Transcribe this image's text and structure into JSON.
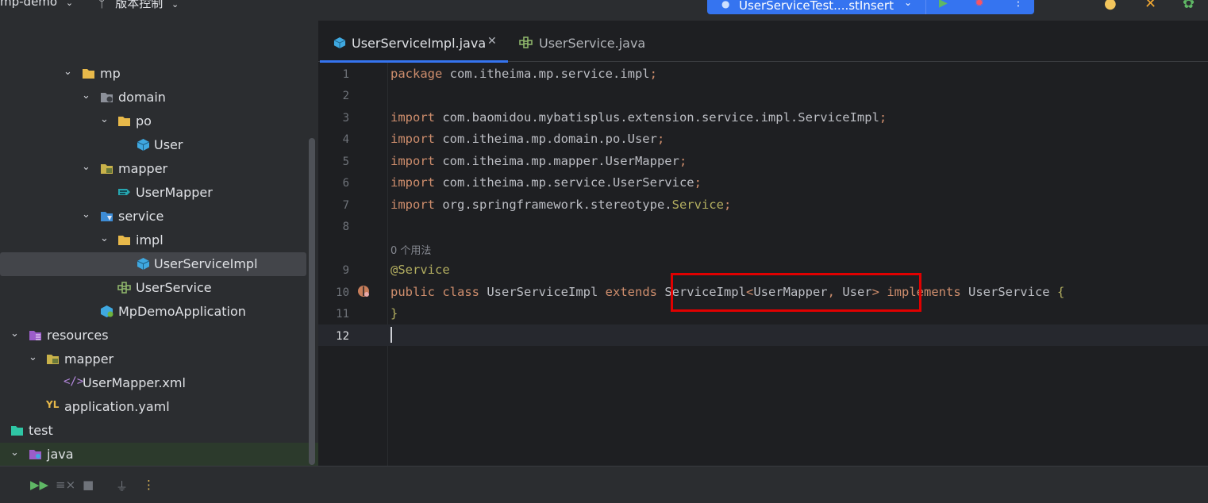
{
  "topbar": {
    "project_name": "mp-demo",
    "vcs_label": "版本控制",
    "run_config_label": "UserServiceTest....stInsert"
  },
  "project_tree": [
    {
      "label": "mp",
      "icon": "folder-icon",
      "expanded": true
    },
    {
      "label": "domain",
      "icon": "package-icon",
      "expanded": true
    },
    {
      "label": "po",
      "icon": "folder-icon",
      "expanded": true
    },
    {
      "label": "User",
      "icon": "class-icon"
    },
    {
      "label": "mapper",
      "icon": "package-icon",
      "expanded": true
    },
    {
      "label": "UserMapper",
      "icon": "mybatis-mapper-icon"
    },
    {
      "label": "service",
      "icon": "package-icon",
      "expanded": true
    },
    {
      "label": "impl",
      "icon": "folder-icon",
      "expanded": true
    },
    {
      "label": "UserServiceImpl",
      "icon": "class-icon",
      "selected": true
    },
    {
      "label": "UserService",
      "icon": "interface-icon"
    },
    {
      "label": "MpDemoApplication",
      "icon": "spring-boot-class-icon"
    },
    {
      "label": "resources",
      "icon": "resources-folder-icon",
      "expanded": true
    },
    {
      "label": "mapper",
      "icon": "folder-icon",
      "expanded": true
    },
    {
      "label": "UserMapper.xml",
      "icon": "xml-file-icon"
    },
    {
      "label": "application.yaml",
      "icon": "yaml-file-icon"
    },
    {
      "label": "test",
      "icon": "test-folder-icon"
    },
    {
      "label": "java",
      "icon": "java-source-folder-icon",
      "expanded": true
    }
  ],
  "tabs": [
    {
      "label": "UserServiceImpl.java",
      "active": true
    },
    {
      "label": "UserService.java",
      "active": false
    }
  ],
  "code": {
    "line_numbers": [
      "1",
      "2",
      "3",
      "4",
      "5",
      "6",
      "7",
      "8",
      "9",
      "10",
      "11",
      "12"
    ],
    "l1_kw": "package",
    "l1_rest": " com.itheima.mp.service.impl",
    "l3_rest": " com.baomidou.mybatisplus.extension.service.impl.ServiceImpl",
    "l4_rest": " com.itheima.mp.domain.po.User",
    "l5_rest": " com.itheima.mp.mapper.UserMapper",
    "l6_rest": " com.itheima.mp.service.UserService",
    "l7_rest": " org.springframework.stereotype.",
    "l7_svc": "Service",
    "import_kw": "import",
    "semicolon": ";",
    "usage_hint": "0 个用法",
    "l9_annotation": "@Service",
    "l10_public": "public",
    "l10_class": "class",
    "l10_name": " UserServiceImpl ",
    "l10_extends": "extends",
    "l10_base": " ServiceImpl",
    "l10_lt": "<",
    "l10_mapper": "UserMapper",
    "l10_comma": ",",
    "l10_user": " User",
    "l10_gt": ">",
    "l10_implements": " implements",
    "l10_iface": " UserService ",
    "l10_brace": "{",
    "l11_brace": "}"
  },
  "colors": {
    "accent": "#3574f0",
    "highlight_box": "#e00000",
    "keyword": "#cf8e6d",
    "annotation": "#b3ae60"
  }
}
